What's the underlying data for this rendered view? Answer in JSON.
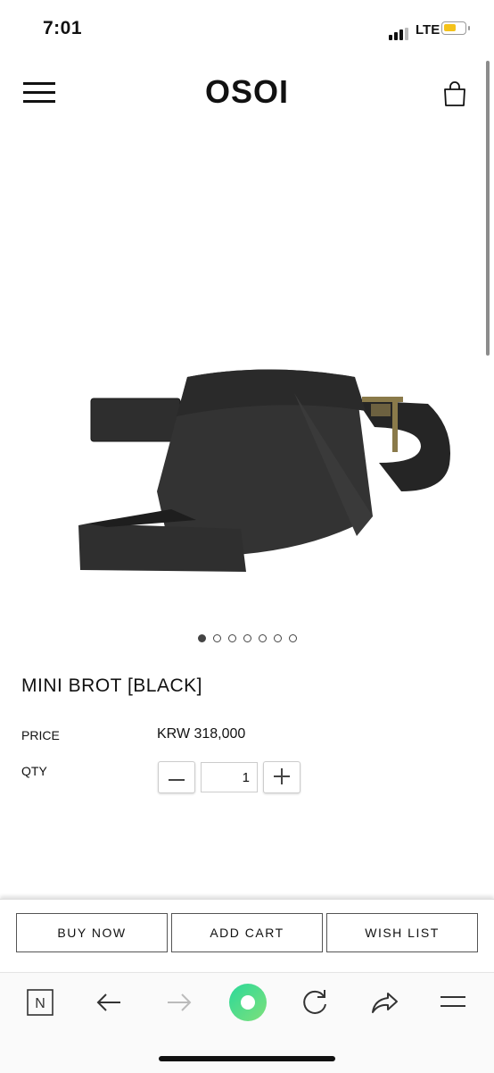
{
  "status_bar": {
    "time": "7:01",
    "network": "LTE",
    "battery_color": "#f4c21a"
  },
  "header": {
    "logo": "OSOI",
    "menu_icon": "hamburger-menu-icon",
    "cart_icon": "shopping-bag-icon"
  },
  "gallery": {
    "total_images": 7,
    "active_index": 0
  },
  "product": {
    "name": "MINI BROT [BLACK]",
    "price_label": "PRICE",
    "price_value": "KRW 318,000",
    "qty_label": "QTY",
    "qty_value": "1",
    "qty_minus": "−",
    "qty_plus": "+"
  },
  "actions": {
    "buy_now": "BUY NOW",
    "add_cart": "ADD CART",
    "wish_list": "WISH LIST"
  },
  "browser_toolbar": {
    "home_label": "N",
    "icons": [
      "naver-home-icon",
      "back-arrow-icon",
      "forward-arrow-icon",
      "green-dot-icon",
      "refresh-icon",
      "share-icon",
      "menu-lines-icon"
    ],
    "accent": "#3ddc84"
  }
}
